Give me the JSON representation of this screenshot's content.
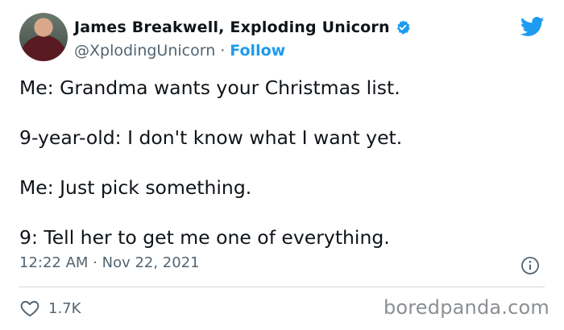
{
  "author": {
    "display_name": "James Breakwell, Exploding Unicorn",
    "handle": "@XplodingUnicorn",
    "separator": "·",
    "follow_label": "Follow"
  },
  "tweet": {
    "lines": [
      "Me: Grandma wants your Christmas list.",
      "9-year-old: I don't know what I want yet.",
      "Me: Just pick something.",
      "9: Tell her to get me one of everything."
    ],
    "time": "12:22 AM · Nov 22, 2021",
    "likes": "1.7K"
  },
  "watermark": "boredpanda.com",
  "colors": {
    "accent": "#1d9bf0",
    "text": "#0f1419",
    "muted": "#536471"
  },
  "icons": [
    "verified-badge-icon",
    "twitter-bird-icon",
    "info-icon",
    "heart-icon"
  ]
}
